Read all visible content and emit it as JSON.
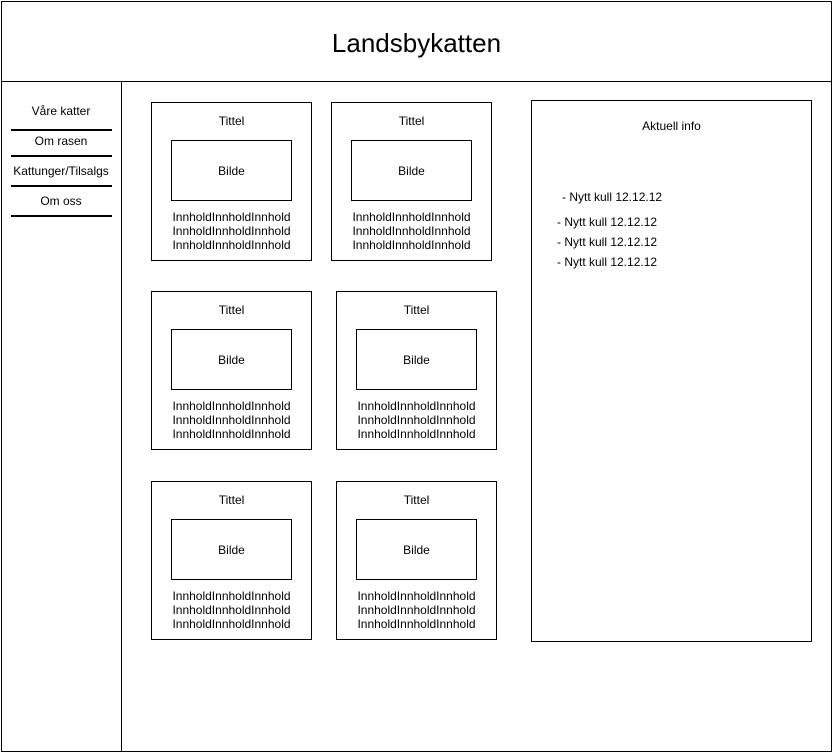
{
  "header": {
    "title": "Landsbykatten"
  },
  "nav": {
    "items": [
      "Våre katter",
      "Om rasen",
      "Kattunger/Tilsalgs",
      "Om oss"
    ]
  },
  "cards": [
    {
      "title": "Tittel",
      "image_label": "Bilde",
      "content": [
        "InnholdInnholdInnhold",
        "InnholdInnholdInnhold",
        "InnholdInnholdInnhold"
      ]
    },
    {
      "title": "Tittel",
      "image_label": "Bilde",
      "content": [
        "InnholdInnholdInnhold",
        "InnholdInnholdInnhold",
        "InnholdInnholdInnhold"
      ]
    },
    {
      "title": "Tittel",
      "image_label": "Bilde",
      "content": [
        "InnholdInnholdInnhold",
        "InnholdInnholdInnhold",
        "InnholdInnholdInnhold"
      ]
    },
    {
      "title": "Tittel",
      "image_label": "Bilde",
      "content": [
        "InnholdInnholdInnhold",
        "InnholdInnholdInnhold",
        "InnholdInnholdInnhold"
      ]
    },
    {
      "title": "Tittel",
      "image_label": "Bilde",
      "content": [
        "InnholdInnholdInnhold",
        "InnholdInnholdInnhold",
        "InnholdInnholdInnhold"
      ]
    },
    {
      "title": "Tittel",
      "image_label": "Bilde",
      "content": [
        "InnholdInnholdInnhold",
        "InnholdInnholdInnhold",
        "InnholdInnholdInnhold"
      ]
    }
  ],
  "info_panel": {
    "title": "Aktuell info",
    "items": [
      "- Nytt kull 12.12.12",
      "- Nytt kull 12.12.12",
      "- Nytt kull 12.12.12",
      "- Nytt kull 12.12.12"
    ]
  }
}
